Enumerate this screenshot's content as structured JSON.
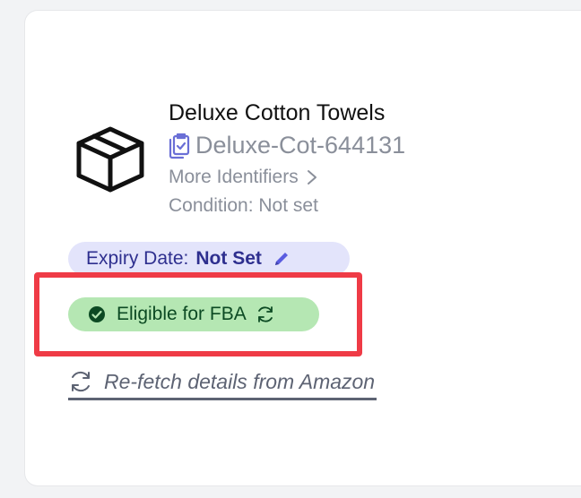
{
  "product": {
    "title": "Deluxe Cotton Towels",
    "sku": "Deluxe-Cot-644131",
    "more_identifiers_label": "More Identifiers",
    "condition_text": "Condition: Not set"
  },
  "expiry": {
    "label": "Expiry Date:",
    "value": "Not Set"
  },
  "fba": {
    "label": "Eligible for FBA"
  },
  "refetch": {
    "label": "Re-fetch details from Amazon"
  },
  "colors": {
    "expiry_pill_bg": "#e3e4fb",
    "expiry_text": "#2e2f8f",
    "fba_pill_bg": "#b5e7b3",
    "fba_text": "#0c4a23",
    "highlight_border": "#ef3b46",
    "muted_text": "#8a8f9a"
  },
  "icons": {
    "product": "box-icon",
    "sku": "clipboard-check-icon",
    "more_identifiers": "chevron-right-icon",
    "expiry_edit": "pencil-icon",
    "fba_status": "check-circle-icon",
    "fba_refresh": "refresh-icon",
    "refetch": "refresh-icon"
  }
}
